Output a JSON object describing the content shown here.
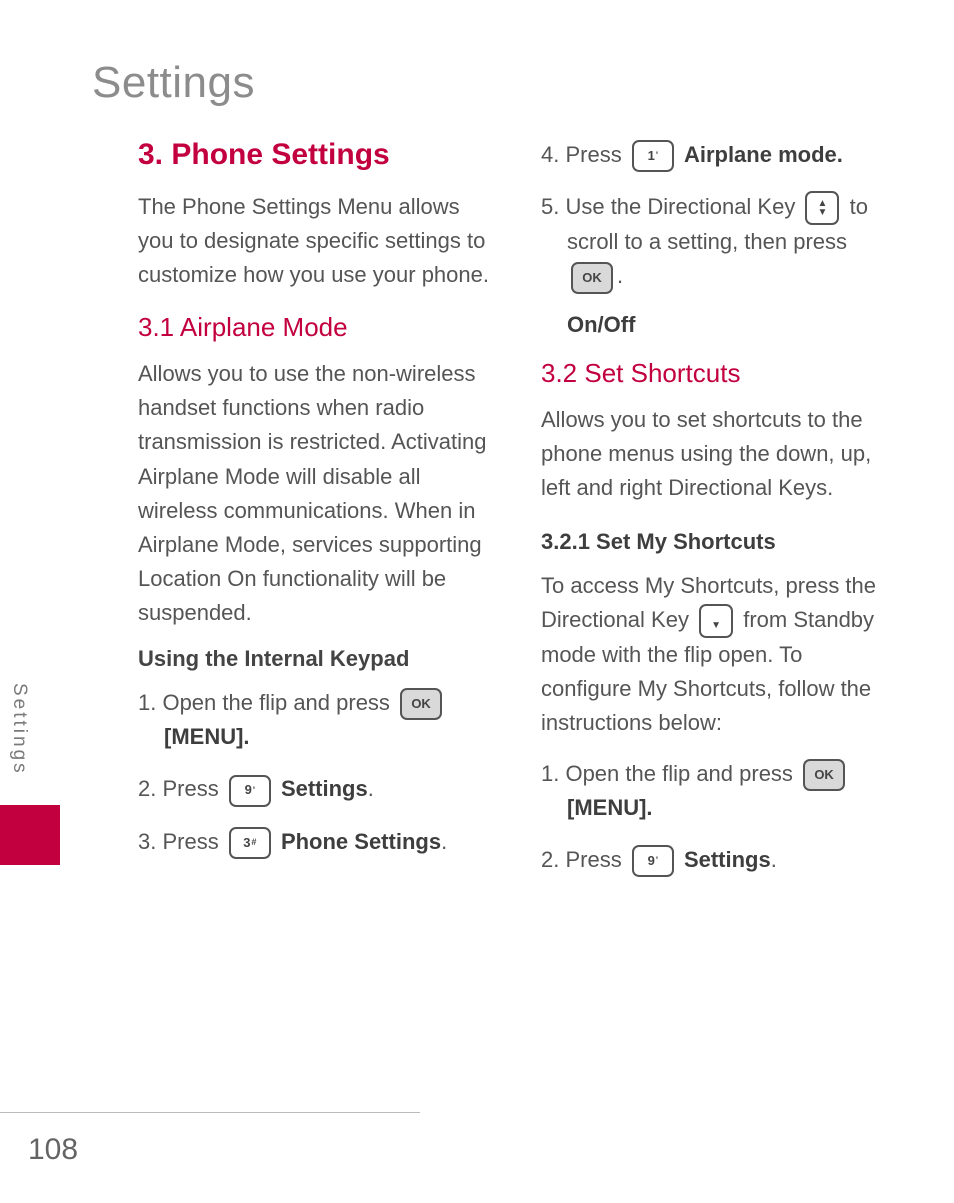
{
  "page_title": "Settings",
  "side_tab": "Settings",
  "page_number": "108",
  "s": {
    "h1": "3. Phone Settings",
    "intro": "The Phone Settings Menu allows you to designate specific settings to customize how you use your phone.",
    "h2_1": "3.1 Airplane Mode",
    "p1": "Allows you to use the non-wireless handset functions when radio transmission is restricted. Activating Airplane Mode will disable all wireless communications. When in Airplane Mode, services supporting Location On functionality will be suspended.",
    "sub1": "Using the Internal Keypad",
    "st1a": "1. Open the flip and press ",
    "st1b": "[MENU].",
    "st2a": "2. Press ",
    "st2b": "Settings",
    "st3a": "3. Press ",
    "st3b": "Phone Settings",
    "st4a": "4. Press ",
    "st4b": "Airplane mode.",
    "st5a": "5. Use the Directional Key ",
    "st5b": "to scroll to a setting, then press ",
    "onoff": "On/Off",
    "h2_2": "3.2 Set Shortcuts",
    "p2": "Allows you to set shortcuts to the phone menus using the down, up, left and right Directional Keys.",
    "h3": "3.2.1 Set My Shortcuts",
    "p3a": "To access My Shortcuts, press the Directional Key ",
    "p3b": "from Standby mode with the flip open. To configure My Shortcuts, follow the instructions below:",
    "st6a": "1. Open the flip and press ",
    "st6b": "[MENU].",
    "st7a": "2. Press ",
    "st7b": "Settings"
  },
  "keys": {
    "ok": "OK",
    "k1": "1",
    "k1s": "'",
    "k3": "3",
    "k3s": "#",
    "k9": "9",
    "k9s": "'"
  }
}
